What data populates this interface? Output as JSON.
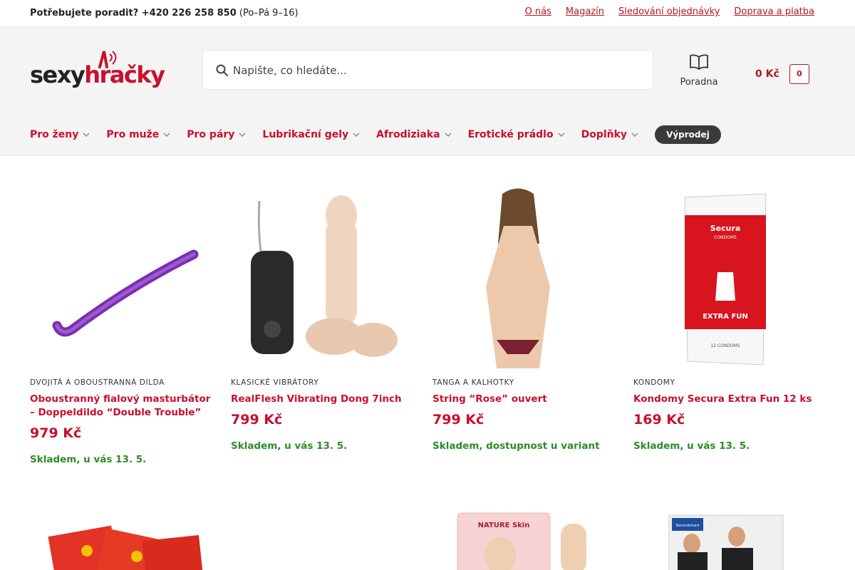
{
  "topbar": {
    "phone_prefix": "Potřebujete poradit? +420 226 258 850",
    "hours": "(Po–Pá 9–16)",
    "links": [
      "O nás",
      "Magazín",
      "Sledování objednávky",
      "Doprava a platba"
    ]
  },
  "header": {
    "logo_text_a": "sexy",
    "logo_text_b": "hračky",
    "search_placeholder": "Napište, co hledáte...",
    "poradna_label": "Poradna",
    "cart_amount": "0",
    "cart_currency": "Kč",
    "cart_count": "0"
  },
  "nav": {
    "items": [
      "Pro ženy",
      "Pro muže",
      "Pro páry",
      "Lubrikační gely",
      "Afrodiziaka",
      "Erotické prádlo",
      "Doplňky"
    ],
    "sale": "Výprodej"
  },
  "products": [
    {
      "category": "DVOJITÁ A OBOUSTRANNÁ DILDA",
      "title": "Oboustranný fialový masturbátor – Doppeldildo “Double Trouble”",
      "price": "979",
      "currency": "Kč",
      "stock": "Skladem, u vás 13. 5."
    },
    {
      "category": "KLASICKÉ VIBRÁTORY",
      "title": "RealFlesh Vibrating Dong 7inch",
      "price": "799",
      "currency": "Kč",
      "stock": "Skladem, u vás 13. 5."
    },
    {
      "category": "TANGA A KALHOTKY",
      "title": "String “Rose” ouvert",
      "price": "799",
      "currency": "Kč",
      "stock": "Skladem, dostupnost u variant"
    },
    {
      "category": "KONDOMY",
      "title": "Kondomy Secura Extra Fun 12 ks",
      "price": "169",
      "currency": "Kč",
      "stock": "Skladem, u vás 13. 5."
    }
  ],
  "product_images": {
    "secura_brand": "Secura",
    "secura_sub": "CONDOMS",
    "secura_title": "EXTRA FUN",
    "secura_count": "12 CONDOMS",
    "nature_skin": "NATURE Skin",
    "second_brand": "Secondsmart"
  },
  "colors": {
    "accent": "#c8102e",
    "stock": "#2e8b28",
    "header_bg": "#f4f4f4"
  }
}
